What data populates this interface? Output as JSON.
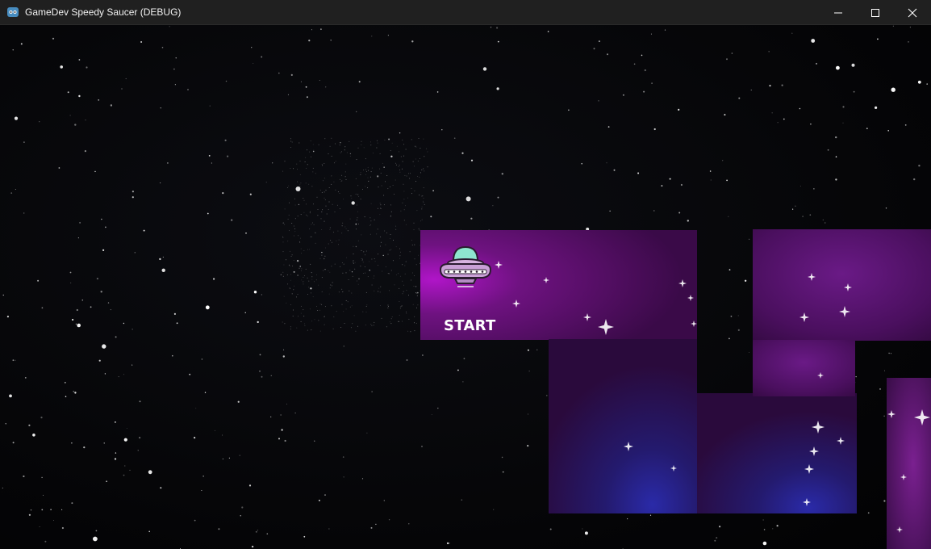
{
  "window": {
    "title": "GameDev Speedy Saucer (DEBUG)",
    "app_icon": "godot-icon",
    "controls": [
      "minimize-icon",
      "maximize-icon",
      "close-icon"
    ]
  },
  "game": {
    "start_label": "START",
    "player_sprite": "ufo-saucer-icon",
    "colors": {
      "space_background": "#050507",
      "nebula_purple": "#5a0f6e",
      "nebula_magenta": "#a010b0",
      "nebula_blue": "#1a1a8a",
      "ufo_dome": "#8ee6cf",
      "ufo_body": "#c9a0d6"
    }
  }
}
